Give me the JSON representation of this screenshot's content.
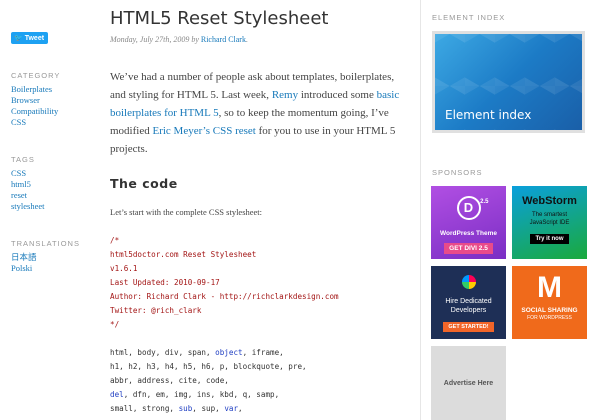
{
  "left": {
    "tweet_label": "Tweet",
    "category": {
      "heading": "CATEGORY",
      "items": [
        "Boilerplates",
        "Browser",
        "Compatibility",
        "CSS"
      ]
    },
    "tags": {
      "heading": "TAGS",
      "items": [
        "CSS",
        "html5",
        "reset",
        "stylesheet"
      ]
    },
    "translations": {
      "heading": "TRANSLATIONS",
      "items": [
        "日本語",
        "Polski"
      ]
    }
  },
  "article": {
    "title": "HTML5 Reset Stylesheet",
    "date": "Monday, July 27th, 2009 by",
    "author": "Richard Clark",
    "intro": {
      "p1": "We’ve had a number of people ask about templates, boilerplates, and styling for HTML 5. Last week,",
      "link1": "Remy",
      "p2": "introduced some",
      "link2": "basic boilerplates for HTML 5",
      "p3": ", so to keep the momentum going, I’ve modified",
      "link3": "Eric Meyer’s CSS reset",
      "p4": "for you to use in your HTML 5 projects."
    },
    "section_heading": "The code",
    "lead": "Let’s start with the complete CSS stylesheet:",
    "code_comment": [
      "/*",
      "html5doctor.com Reset Stylesheet",
      "v1.6.1",
      "Last Updated: 2010-09-17",
      "Author: Richard Clark - http://richclarkdesign.com",
      "Twitter: @rich_clark",
      "*/"
    ],
    "code_lines": [
      [
        [
          "html, body, div, span, ",
          ""
        ],
        [
          "object",
          "kw"
        ],
        [
          ", iframe,",
          ""
        ]
      ],
      [
        [
          "h1, h2, h3, h4, h5, h6, p, blockquote, pre,",
          ""
        ]
      ],
      [
        [
          "abbr, address, cite, code,",
          ""
        ]
      ],
      [
        [
          "del",
          "kw"
        ],
        [
          ", dfn, em, img, ins, kbd, q, samp,",
          ""
        ]
      ],
      [
        [
          "small, strong, ",
          ""
        ],
        [
          "sub",
          "kw"
        ],
        [
          ", sup, ",
          ""
        ],
        [
          "var",
          "kw"
        ],
        [
          ",",
          ""
        ]
      ]
    ]
  },
  "sidebar": {
    "element_index_heading": "ELEMENT INDEX",
    "element_index_label": "Element index",
    "sponsors_heading": "SPONSORS",
    "ads": {
      "divi": {
        "logo": "D",
        "sup": "2.5",
        "title": "WordPress Theme",
        "button": "GET DIVI 2.5"
      },
      "webstorm": {
        "name": "WebStorm",
        "sub1": "The smartest",
        "sub2": "JavaScript IDE",
        "button": "Try it now"
      },
      "dev": {
        "line1": "Hire Dedicated",
        "line2": "Developers",
        "button": "GET STARTED!"
      },
      "social": {
        "mark": "M",
        "title": "SOCIAL SHARING",
        "sub": "FOR WORDPRESS"
      },
      "here": "Advertise Here"
    }
  },
  "colors": {
    "link": "#1779ba",
    "comment": "#a31515",
    "keyword": "#1f3ec2",
    "tweet": "#1da1f2"
  }
}
